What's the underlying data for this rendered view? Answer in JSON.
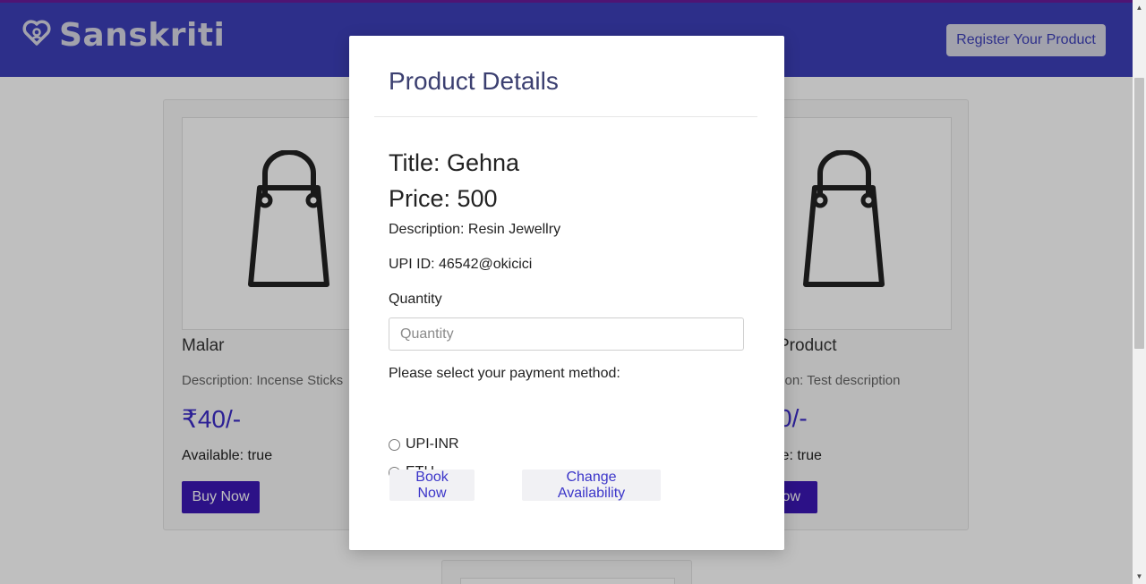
{
  "navbar": {
    "brand": "Sanskriti",
    "register_button": "Register Your Product"
  },
  "products": [
    {
      "name": "Malar",
      "description": "Description: Incense Sticks",
      "price": "₹40/-",
      "available": "Available: true",
      "buy_label": "Buy Now"
    },
    {
      "name": "Product",
      "description": "tion: Test description",
      "price": "0/-",
      "available": "le: true",
      "buy_label": "low"
    }
  ],
  "modal": {
    "heading": "Product Details",
    "title": "Title: Gehna",
    "price": "Price: 500",
    "description": "Description: Resin Jewellry",
    "upi": "UPI ID: 46542@okicici",
    "quantity_label": "Quantity",
    "quantity_placeholder": "Quantity",
    "payment_prompt": "Please select your payment method:",
    "payment_options": [
      "UPI-INR",
      "ETH"
    ],
    "book_button": "Book Now",
    "availability_button": "Change Availability"
  },
  "colors": {
    "navbar": "#3d3fb8",
    "accent": "#3b17b5",
    "price": "#3b2bc7",
    "modal_heading": "#3b3f70"
  }
}
